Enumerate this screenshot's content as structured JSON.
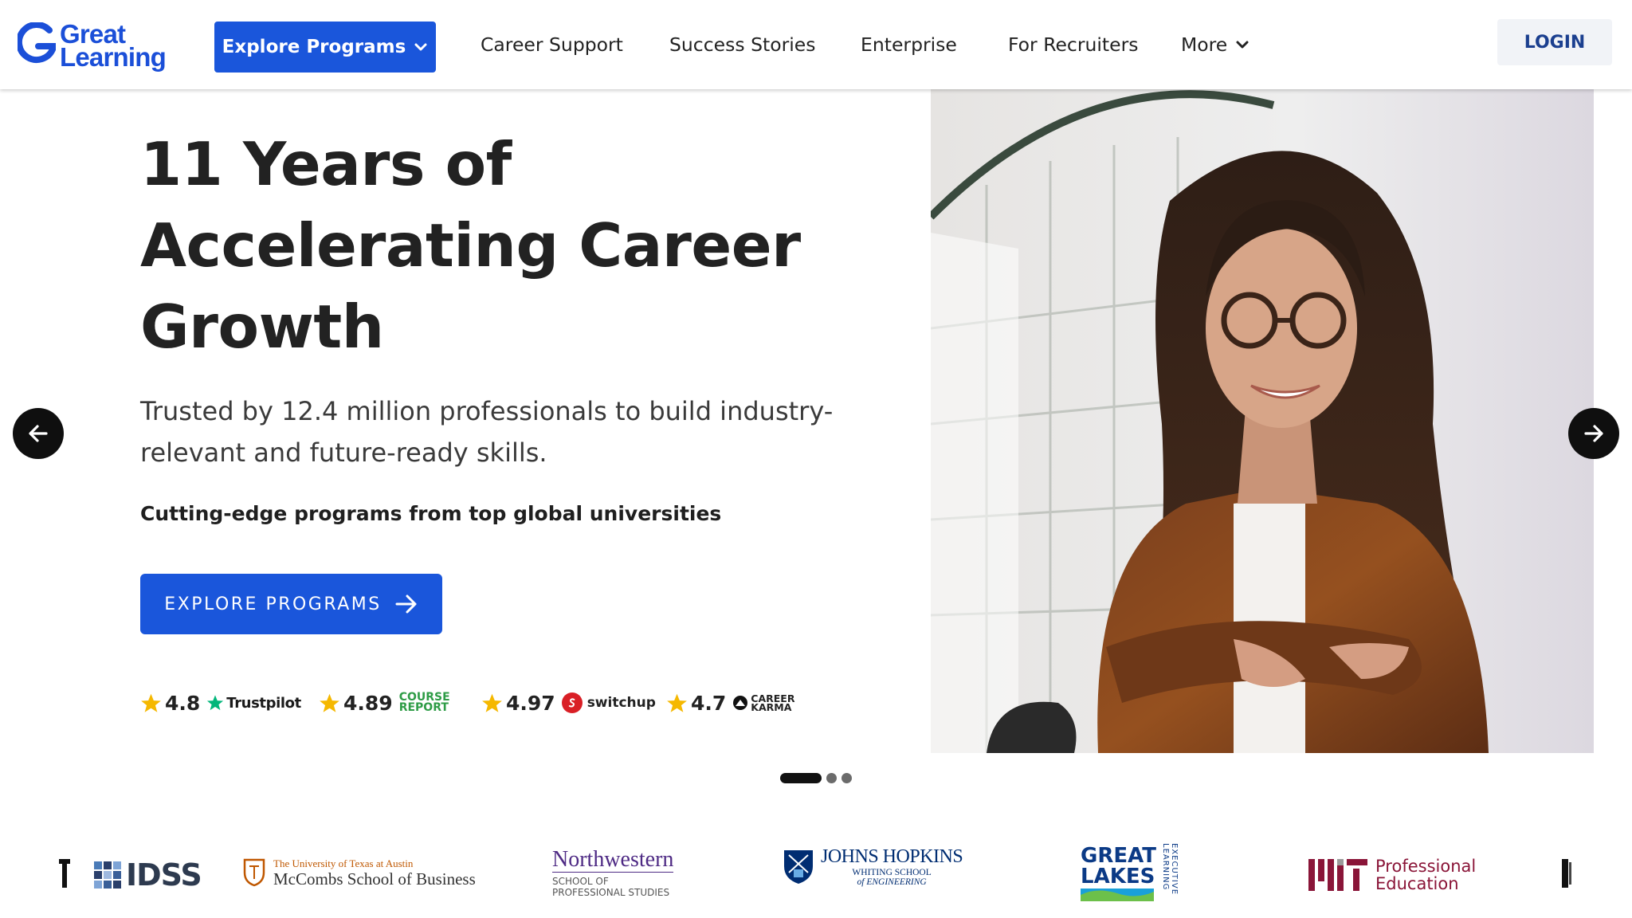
{
  "header": {
    "logo_line1": "Great",
    "logo_line2": "Learning",
    "explore_label": "Explore Programs",
    "nav": [
      {
        "label": "Career Support"
      },
      {
        "label": "Success Stories"
      },
      {
        "label": "Enterprise"
      },
      {
        "label": "For Recruiters"
      },
      {
        "label": "More"
      }
    ],
    "login_label": "LOGIN"
  },
  "hero": {
    "title_lines": [
      "11 Years of",
      "Accelerating Career",
      "Growth"
    ],
    "subtitle_line1": "Trusted by 12.4 million professionals to build industry-",
    "subtitle_line2": "relevant and future-ready skills.",
    "tagline": "Cutting-edge programs from top global universities",
    "cta_label": "EXPLORE PROGRAMS"
  },
  "ratings": [
    {
      "value": "4.8",
      "source": "Trustpilot"
    },
    {
      "value": "4.89",
      "source_line1": "COURSE",
      "source_line2": "REPORT"
    },
    {
      "value": "4.97",
      "source": "switchup"
    },
    {
      "value": "4.7",
      "source_line1": "CAREER",
      "source_line2": "KARMA"
    }
  ],
  "carousel": {
    "slide_count": 3,
    "active_index": 0
  },
  "universities": {
    "idss": "IDSS",
    "mccombs_line1": "The University of Texas at Austin",
    "mccombs_line2": "McCombs School of Business",
    "northwestern_line1": "Northwestern",
    "northwestern_line2": "SCHOOL OF",
    "northwestern_line3": "PROFESSIONAL STUDIES",
    "jhu_line1": "JOHNS HOPKINS",
    "jhu_line2": "WHITING SCHOOL",
    "jhu_line3": "of ENGINEERING",
    "greatlakes_line1": "GREAT",
    "greatlakes_line2": "LAKES",
    "greatlakes_side": "EXECUTIVE LEARNING",
    "mit_line1": "Professional",
    "mit_line2": "Education"
  },
  "colors": {
    "primary": "#1a56db",
    "logo_blue": "#1b4fd8",
    "star": "#f5b800",
    "trustpilot": "#00b67a",
    "course_report": "#2e9c46",
    "switchup": "#d91f26",
    "mit_red": "#8a1538"
  },
  "icons": [
    "chevron-down-icon",
    "arrow-right-icon",
    "arrow-left-icon",
    "star-icon"
  ]
}
